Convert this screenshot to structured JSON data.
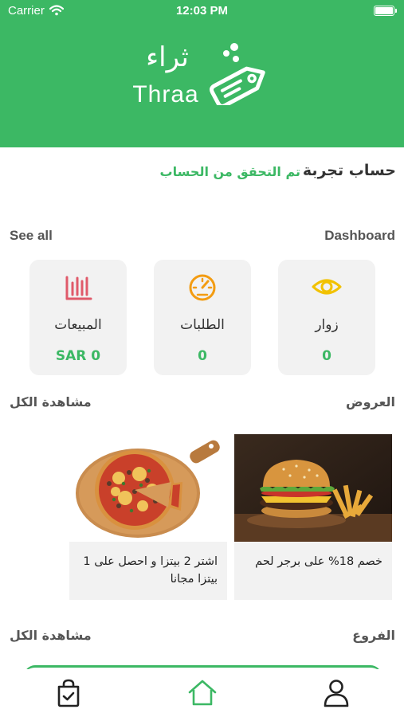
{
  "status_bar": {
    "carrier": "Carrier",
    "time": "12:03 PM"
  },
  "brand": {
    "name_ar": "ثراء",
    "name_en": "Thraa",
    "color": "#3cb864"
  },
  "account": {
    "name": "حساب تجربة",
    "status": "تم التحقق من الحساب"
  },
  "dashboard": {
    "title": "Dashboard",
    "see_all": "See all",
    "stats": [
      {
        "label": "زوار",
        "value": "0",
        "icon": "eye-icon",
        "icon_color": "#f2c200"
      },
      {
        "label": "الطلبات",
        "value": "0",
        "icon": "speedometer-icon",
        "icon_color": "#f39c12"
      },
      {
        "label": "المبيعات",
        "value": "SAR 0",
        "icon": "bar-chart-icon",
        "icon_color": "#e05a6a"
      }
    ]
  },
  "offers": {
    "title": "العروض",
    "see_all": "مشاهدة الكل",
    "items": [
      {
        "text": "خصم 18% على برجر لحم",
        "image": "burger-image"
      },
      {
        "text": "اشتر 2 بيتزا و احصل على 1 بيتزا مجانا",
        "image": "pizza-image"
      }
    ]
  },
  "branches": {
    "title": "الفروع",
    "see_all": "مشاهدة الكل"
  },
  "tabbar": {
    "items": [
      "profile-icon",
      "home-icon",
      "orders-bag-icon"
    ]
  }
}
